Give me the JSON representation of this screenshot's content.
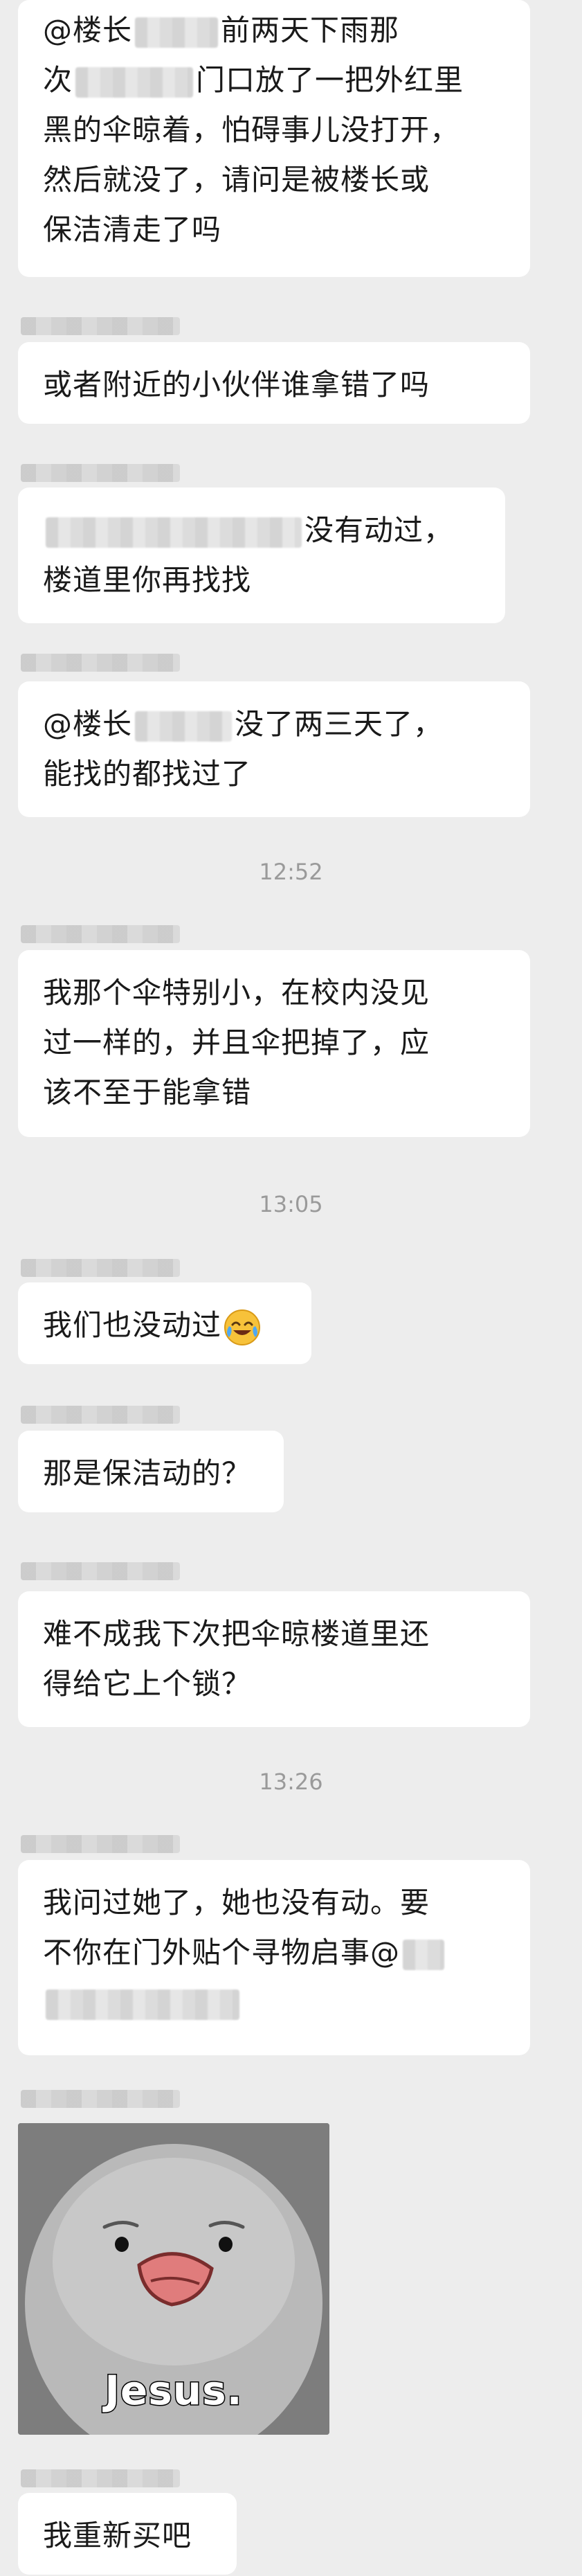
{
  "messages": [
    {
      "lines": [
        "@楼长",
        "前两天下雨那",
        "次",
        "门口放了一把外红里",
        "黑的伞晾着，怕碍事儿没打开，",
        "然后就没了，请问是被楼长或",
        "保洁清走了吗"
      ]
    },
    {
      "text": "或者附近的小伙伴谁拿错了吗"
    },
    {
      "lines": [
        "没有动过，",
        "楼道里你再找找"
      ]
    },
    {
      "lines": [
        "@楼长",
        "没了两三天了，",
        "能找的都找过了"
      ]
    },
    {
      "time": "12:52"
    },
    {
      "lines": [
        "我那个伞特别小，在校内没见",
        "过一样的，并且伞把掉了，应",
        "该不至于能拿错"
      ]
    },
    {
      "time": "13:05"
    },
    {
      "text": "我们也没动过",
      "emoji": "crying-laughing-emoji"
    },
    {
      "text": "那是保洁动的？"
    },
    {
      "lines": [
        "难不成我下次把伞晾楼道里还",
        "得给它上个锁？"
      ]
    },
    {
      "time": "13:26"
    },
    {
      "lines": [
        "我问过她了，她也没有动。要",
        "不你在门外贴个寻物启事@"
      ]
    },
    {
      "sticker": {
        "caption": "Jesus.",
        "icon": "sad-bird-sticker"
      }
    },
    {
      "text": "我重新买吧"
    }
  ]
}
